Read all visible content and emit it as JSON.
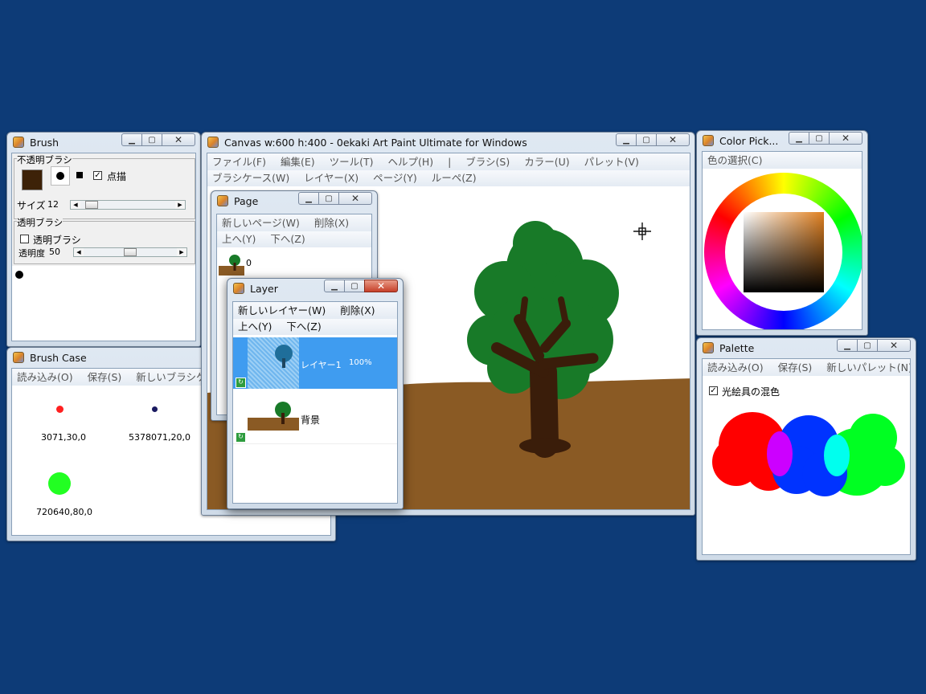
{
  "brush": {
    "title": "Brush",
    "opaque_group": "不透明ブラシ",
    "dot_mode_label": "点描",
    "size_label": "サイズ",
    "size_value": 12,
    "transparent_group": "透明ブラシ",
    "transparent_brush_label": "透明ブラシ",
    "opacity_label": "透明度",
    "opacity_value": 50,
    "brush_color": "#3d2208"
  },
  "canvas": {
    "title": "Canvas w:600 h:400 - 0ekaki Art Paint Ultimate for Windows",
    "menu1": [
      "ファイル(F)",
      "編集(E)",
      "ツール(T)",
      "ヘルプ(H)",
      "|",
      "ブラシ(S)",
      "カラー(U)",
      "パレット(V)"
    ],
    "menu2": [
      "ブラシケース(W)",
      "レイヤー(X)",
      "ページ(Y)",
      "ルーペ(Z)"
    ]
  },
  "page": {
    "title": "Page",
    "menu1": [
      "新しいページ(W)",
      "削除(X)"
    ],
    "menu2": [
      "上へ(Y)",
      "下へ(Z)"
    ],
    "item_label": "0"
  },
  "layer": {
    "title": "Layer",
    "menu1": [
      "新しいレイヤー(W)",
      "削除(X)"
    ],
    "menu2": [
      "上へ(Y)",
      "下へ(Z)"
    ],
    "layers": [
      {
        "label": "レイヤー1",
        "opacity": "100%"
      },
      {
        "label": "背景"
      }
    ]
  },
  "brush_case": {
    "title": "Brush Case",
    "menu": [
      "読み込み(O)",
      "保存(S)",
      "新しいブラシケース"
    ],
    "items": [
      {
        "label": "3071,30,0",
        "color": "#ff2020"
      },
      {
        "label": "5378071,20,0",
        "color": "#1a1a60"
      },
      {
        "label": "720640,80,0",
        "color": "#22ff22"
      }
    ]
  },
  "color_picker": {
    "title": "Color Pick...",
    "menu": [
      "色の選択(C)"
    ]
  },
  "palette": {
    "title": "Palette",
    "menu": [
      "読み込み(O)",
      "保存(S)",
      "新しいパレット(N)"
    ],
    "mix_label": "光絵具の混色"
  }
}
